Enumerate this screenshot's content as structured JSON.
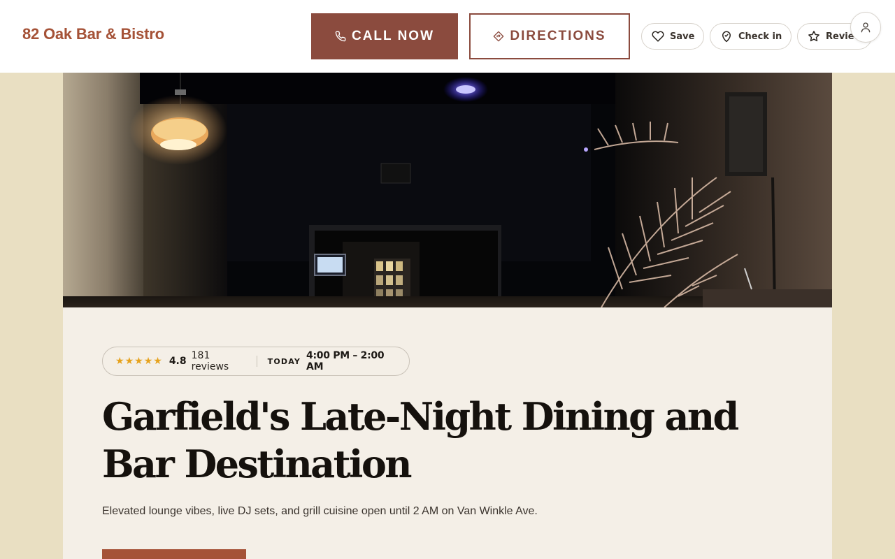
{
  "header": {
    "brand": "82 Oak Bar & Bistro",
    "call_label": "CALL NOW",
    "directions_label": "DIRECTIONS",
    "save_label": "Save",
    "checkin_label": "Check in",
    "review_label": "Review",
    "icons": {
      "call": "phone-icon",
      "directions": "directions-icon",
      "save": "heart-icon",
      "checkin": "location-pin-icon",
      "review": "star-outline-icon",
      "account": "user-icon"
    }
  },
  "summary": {
    "rating": "4.8",
    "rating_value": 4.8,
    "star_count": 5,
    "reviews": "181 reviews",
    "today_label": "TODAY",
    "hours": "4:00 PM – 2:00 AM"
  },
  "hero": {
    "headline": "Garfield's Late-Night Dining and Bar Destination",
    "subline": "Elevated lounge vibes, live DJ sets, and grill cuisine open until 2 AM on Van Winkle Ave."
  },
  "colors": {
    "brand": "#a55237",
    "call_button": "#8b4b3e",
    "star": "#e6a21c",
    "page_background": "#e9dfc2",
    "card_background": "#f4efe7"
  }
}
